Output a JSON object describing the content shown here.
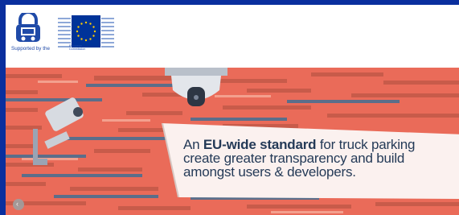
{
  "header": {
    "supported_text": "Supported by the",
    "ec_line1": "European",
    "ec_line2": "Commission"
  },
  "banner": {
    "line1_pre": "An ",
    "line1_bold": "EU-wide standard",
    "line1_post": " for truck parking",
    "line2": "create greater transparency and build",
    "line3": "amongst users & developers."
  },
  "icons": {
    "logo": "lock-truck-logo-icon",
    "flag": "eu-flag-icon",
    "camera_left": "security-camera-icon",
    "camera_dome": "dome-camera-icon",
    "prev": "chevron-left-icon"
  },
  "colors": {
    "outer_border": "#0a2f9e",
    "banner_bg": "#ea6b59",
    "text": "#243a57",
    "eu_flag": "#003399",
    "eu_stars": "#ffcc00"
  }
}
